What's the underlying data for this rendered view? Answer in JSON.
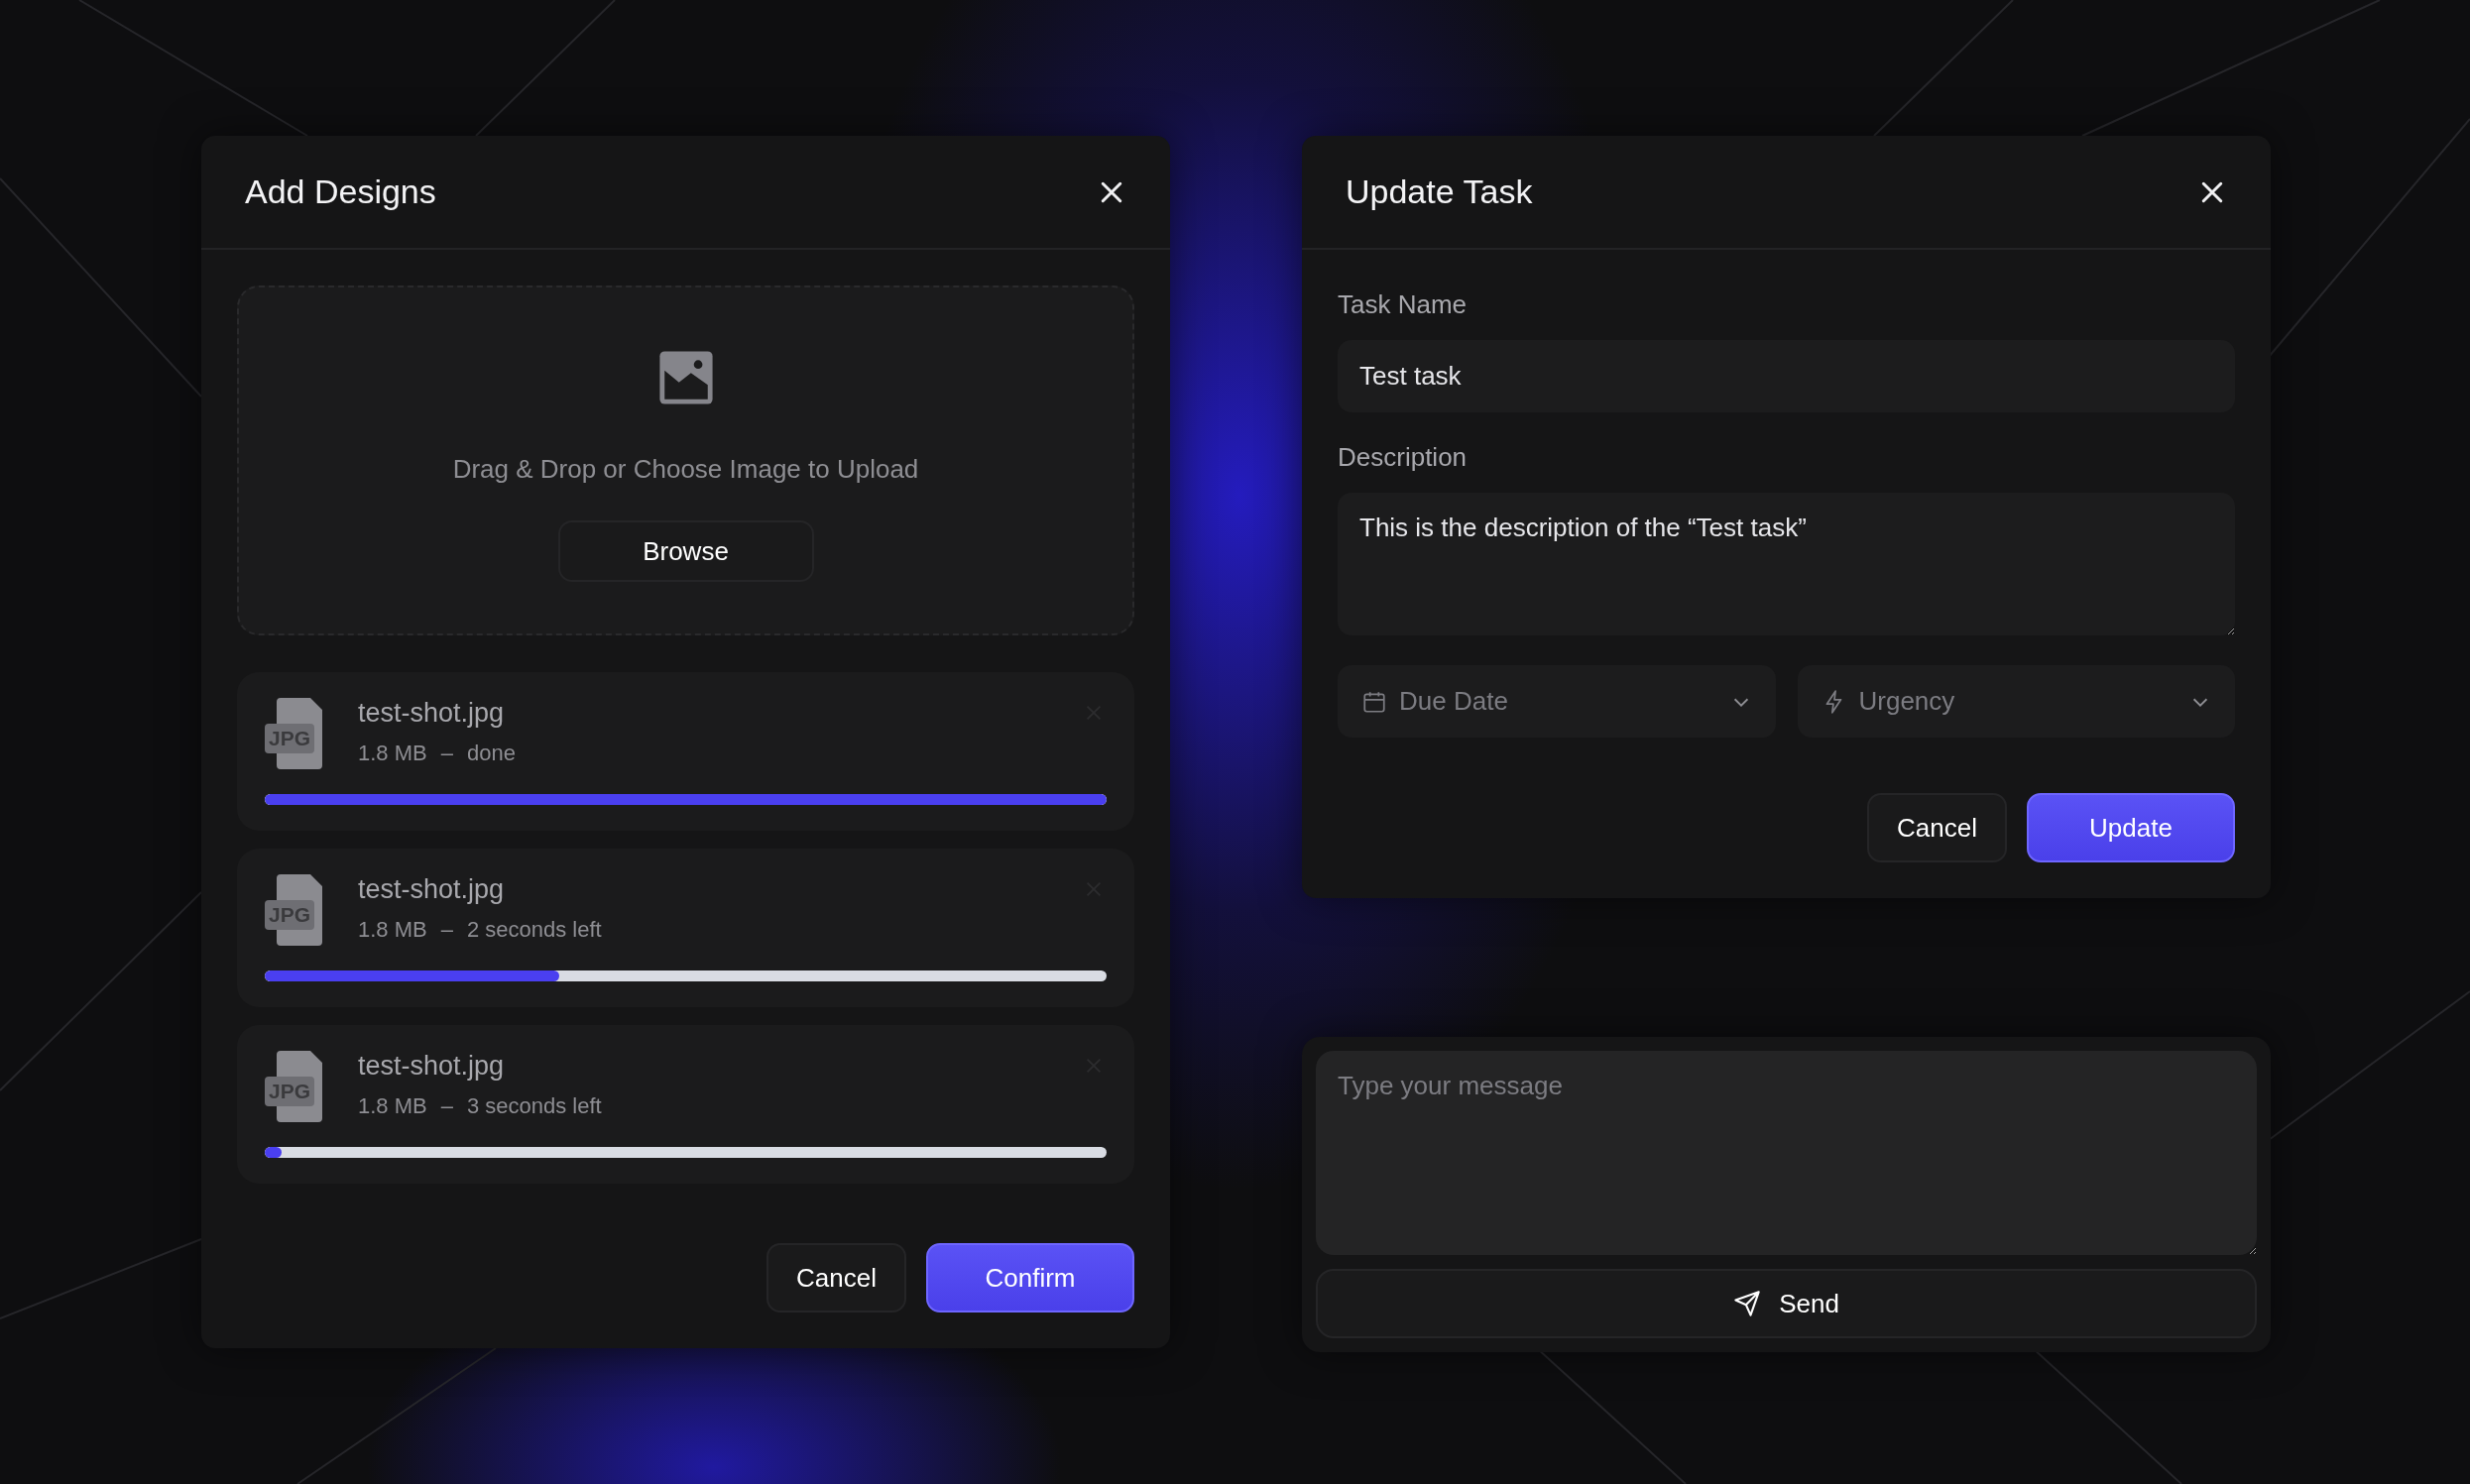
{
  "add_designs": {
    "title": "Add Designs",
    "dropzone": {
      "text": "Drag & Drop or Choose Image to Upload",
      "button": "Browse"
    },
    "files": [
      {
        "badge": "JPG",
        "name": "test-shot.jpg",
        "size": "1.8 MB",
        "separator": "–",
        "status": "done",
        "level": 1
      },
      {
        "badge": "JPG",
        "name": "test-shot.jpg",
        "size": "1.8 MB",
        "separator": "–",
        "status": "2 seconds left",
        "level": 0.35
      },
      {
        "badge": "JPG",
        "name": "test-shot.jpg",
        "size": "1.8 MB",
        "separator": "–",
        "status": "3 seconds left",
        "level": 0.02
      }
    ],
    "buttons": {
      "cancel": "Cancel",
      "confirm": "Confirm"
    }
  },
  "update_task": {
    "title": "Update Task",
    "task_name": {
      "label": "Task Name",
      "value": "Test task"
    },
    "description": {
      "label": "Description",
      "value": "This is the description of the “Test task”"
    },
    "selects": [
      {
        "kind": "date",
        "placeholder": "Due Date"
      },
      {
        "kind": "urgency",
        "placeholder": "Urgency"
      }
    ],
    "buttons": {
      "cancel": "Cancel",
      "update": "Update"
    }
  },
  "message": {
    "placeholder": "Type your message",
    "send": "Send"
  }
}
